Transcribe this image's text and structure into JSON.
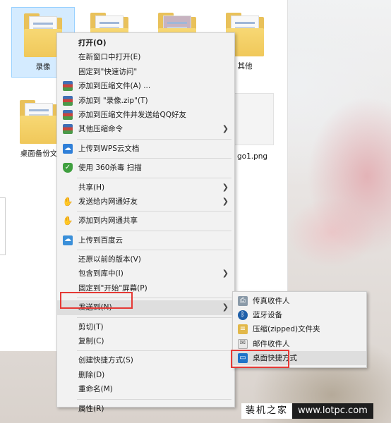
{
  "files": [
    {
      "label": "录像"
    },
    {
      "label": "其他"
    },
    {
      "label": "桌面备份文"
    },
    {
      "label": "go1.png"
    }
  ],
  "context_menu": {
    "items": [
      {
        "label": "打开(O)",
        "bold": true
      },
      {
        "label": "在新窗口中打开(E)"
      },
      {
        "label": "固定到\"快速访问\""
      },
      {
        "label": "添加到压缩文件(A) ...",
        "icon": "winrar-icon"
      },
      {
        "label": "添加到 \"录像.zip\"(T)",
        "icon": "winrar-icon"
      },
      {
        "label": "添加到压缩文件并发送给QQ好友",
        "icon": "winrar-icon"
      },
      {
        "label": "其他压缩命令",
        "icon": "winrar-icon",
        "submenu": true
      },
      {
        "label": "上传到WPS云文档",
        "icon": "wps-cloud-icon"
      },
      {
        "label": "使用 360杀毒 扫描",
        "icon": "shield-360-icon"
      },
      {
        "label": "共享(H)",
        "icon": "share-icon",
        "submenu": true
      },
      {
        "label": "发送给内网通好友",
        "icon": "lan-share-icon",
        "submenu": true
      },
      {
        "label": "添加到内网通共享",
        "icon": "lan-share-icon"
      },
      {
        "label": "上传到百度云",
        "icon": "baidu-cloud-icon"
      },
      {
        "label": "还原以前的版本(V)"
      },
      {
        "label": "包含到库中(I)",
        "submenu": true
      },
      {
        "label": "固定到\"开始\"屏幕(P)"
      },
      {
        "label": "发送到(N)",
        "submenu": true
      },
      {
        "label": "剪切(T)"
      },
      {
        "label": "复制(C)"
      },
      {
        "label": "创建快捷方式(S)"
      },
      {
        "label": "删除(D)"
      },
      {
        "label": "重命名(M)"
      },
      {
        "label": "属性(R)"
      }
    ]
  },
  "send_to_menu": {
    "items": [
      {
        "label": "传真收件人",
        "icon": "fax-icon"
      },
      {
        "label": "蓝牙设备",
        "icon": "bluetooth-icon"
      },
      {
        "label": "压缩(zipped)文件夹",
        "icon": "zip-folder-icon"
      },
      {
        "label": "邮件收件人",
        "icon": "mail-icon"
      },
      {
        "label": "桌面快捷方式",
        "icon": "desktop-icon"
      }
    ]
  },
  "watermark": {
    "left_text": "装机之家",
    "right_text": "www.lotpc.com"
  },
  "colors": {
    "highlight_box": "#e53935",
    "menu_bg": "#f2f2f2",
    "selection_bg": "#cce8ff"
  }
}
